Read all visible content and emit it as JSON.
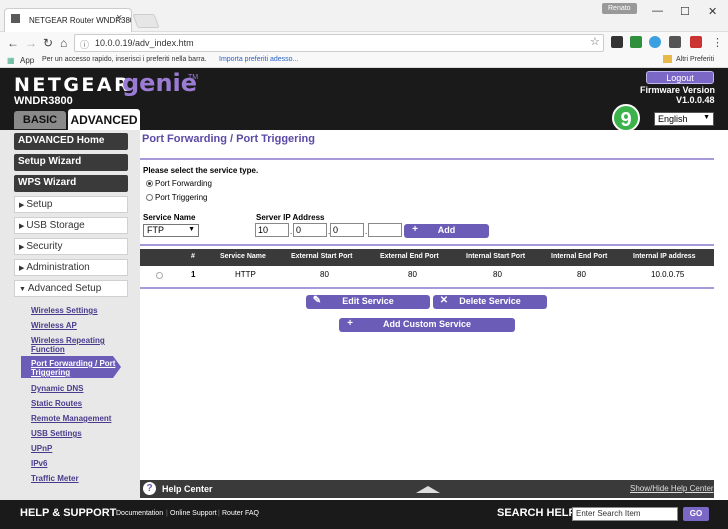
{
  "browser": {
    "tab_title": "NETGEAR Router WNDR3800",
    "user": "Renato",
    "url": "10.0.0.19/adv_index.htm",
    "bookmarks": {
      "apps": "App",
      "hint": "Per un accesso rapido, inserisci i preferiti nella barra.",
      "import": "Importa preferiti adesso...",
      "other": "Altri Preferiti"
    }
  },
  "header": {
    "logo": "NETGEAR",
    "genie": "genie",
    "tm": "TM",
    "model": "WNDR3800",
    "tabs": {
      "basic": "BASIC",
      "advanced": "ADVANCED"
    },
    "logout": "Logout",
    "badge": "9",
    "firmware_label": "Firmware Version",
    "firmware_version": "V1.0.0.48",
    "language": "English"
  },
  "sidebar": {
    "buttons": [
      "ADVANCED Home",
      "Setup Wizard",
      "WPS Wizard"
    ],
    "menus": [
      "Setup",
      "USB Storage",
      "Security",
      "Administration",
      "Advanced Setup"
    ],
    "sub_items": [
      "Wireless Settings",
      "Wireless AP",
      "Wireless Repeating Function",
      "Port Forwarding / Port Triggering",
      "Dynamic DNS",
      "Static Routes",
      "Remote Management",
      "USB Settings",
      "UPnP",
      "IPv6",
      "Traffic Meter"
    ]
  },
  "main": {
    "title": "Port Forwarding / Port Triggering",
    "service_type_prompt": "Please select the service type.",
    "radio_forwarding": "Port Forwarding",
    "radio_triggering": "Port Triggering",
    "service_name_label": "Service Name",
    "service_name_value": "FTP",
    "server_ip_label": "Server IP Address",
    "ip": [
      "10",
      "0",
      "0",
      ""
    ],
    "add_button": "Add",
    "table": {
      "headers": [
        "#",
        "Service Name",
        "External Start Port",
        "External End Port",
        "Internal Start Port",
        "Internal End Port",
        "Internal IP address"
      ],
      "rows": [
        [
          "1",
          "HTTP",
          "80",
          "80",
          "80",
          "80",
          "10.0.0.75"
        ]
      ]
    },
    "edit_button": "Edit Service",
    "delete_button": "Delete Service",
    "add_custom_button": "Add Custom Service"
  },
  "help": {
    "title": "Help Center",
    "toggle": "Show/Hide Help Center"
  },
  "footer": {
    "title": "HELP & SUPPORT",
    "links": [
      "Documentation",
      "Online Support",
      "Router FAQ"
    ],
    "search_label": "SEARCH HELP",
    "search_placeholder": "Enter Search Item",
    "go": "GO"
  }
}
